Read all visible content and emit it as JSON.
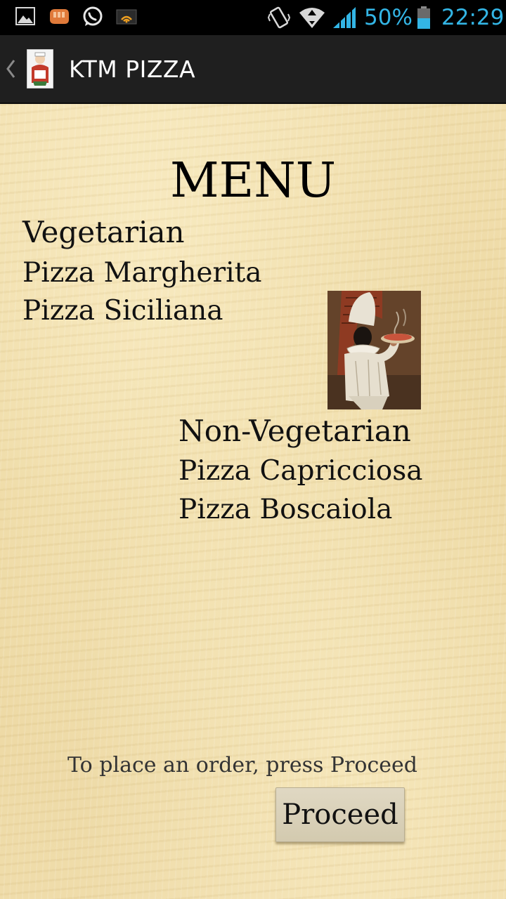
{
  "status_bar": {
    "battery_percent": "50%",
    "time": "22:29",
    "icons": [
      "picture-icon",
      "bbm-icon",
      "whatsapp-icon",
      "wifi-hotspot-icon",
      "vibrate-icon",
      "wifi-icon",
      "signal-icon",
      "battery-icon"
    ],
    "accent_color": "#33b5e5"
  },
  "action_bar": {
    "title": "KTM PIZZA",
    "background_color": "#1f1f1f"
  },
  "menu": {
    "title": "MENU",
    "vegetarian": {
      "heading": "Vegetarian",
      "items": [
        "Pizza Margherita",
        "Pizza Siciliana"
      ]
    },
    "non_vegetarian": {
      "heading": "Non-Vegetarian",
      "items": [
        "Pizza Capricciosa",
        "Pizza Boscaiola"
      ]
    }
  },
  "footer": {
    "hint": "To place an order, press Proceed",
    "proceed_label": "Proceed"
  },
  "colors": {
    "parchment": "#efdca7",
    "text": "#111111"
  }
}
